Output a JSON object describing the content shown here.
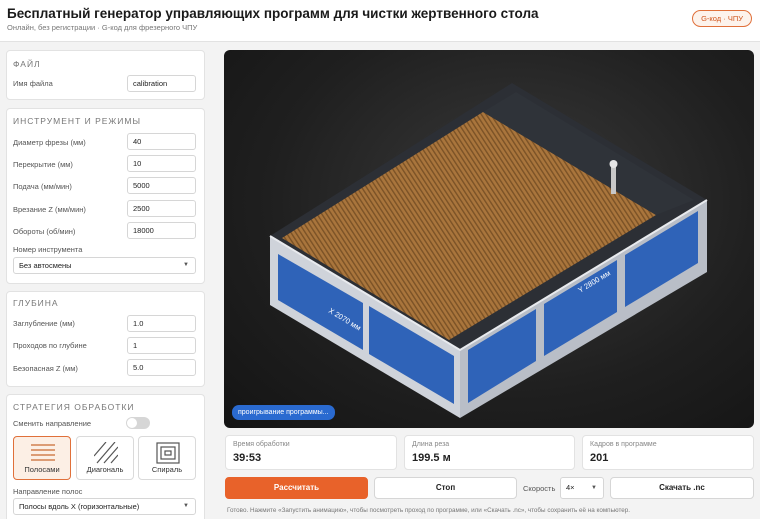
{
  "header": {
    "title": "Бесплатный генератор управляющих программ для чистки жертвенного стола",
    "subtitle": "Онлайн, без регистрации · G-код для фрезерного ЧПУ",
    "badge": "G-код · ЧПУ"
  },
  "file": {
    "section_title": "ФАЙЛ",
    "filename_label": "Имя файла",
    "filename_value": "calibration"
  },
  "tool": {
    "section_title": "ИНСТРУМЕНТ И РЕЖИМЫ",
    "fields": [
      {
        "label": "Диаметр фрезы (мм)",
        "value": "40"
      },
      {
        "label": "Перекрытие (мм)",
        "value": "10"
      },
      {
        "label": "Подача (мм/мин)",
        "value": "5000"
      },
      {
        "label": "Врезание Z (мм/мин)",
        "value": "2500"
      },
      {
        "label": "Обороты (об/мин)",
        "value": "18000"
      }
    ],
    "tool_number_label": "Номер инструмента",
    "tool_number_value": "Без автосмены"
  },
  "depth": {
    "section_title": "ГЛУБИНА",
    "fields": [
      {
        "label": "Заглубление (мм)",
        "value": "1.0"
      },
      {
        "label": "Проходов по глубине",
        "value": "1"
      },
      {
        "label": "Безопасная Z (мм)",
        "value": "5.0"
      }
    ]
  },
  "strategy": {
    "section_title": "СТРАТЕГИЯ ОБРАБОТКИ",
    "toggle_label": "Сменить направление",
    "toggle_on": false,
    "options": [
      {
        "label": "Полосами",
        "icon": "stripes-icon",
        "active": true
      },
      {
        "label": "Диагональ",
        "icon": "diagonal-icon",
        "active": false
      },
      {
        "label": "Спираль",
        "icon": "spiral-icon",
        "active": false
      }
    ],
    "direction_label": "Направление полос",
    "direction_value": "Полосы вдоль X (горизонтальные)"
  },
  "viewer": {
    "x_dim_label": "X 2070 мм",
    "y_dim_label": "Y 2800 мм",
    "playback_pill": "проигрывание программы..."
  },
  "stats": [
    {
      "label": "Время обработки",
      "value": "39:53"
    },
    {
      "label": "Длина реза",
      "value": "199.5 м"
    },
    {
      "label": "Кадров в программе",
      "value": "201"
    }
  ],
  "actions": {
    "calculate": "Рассчитать",
    "stop": "Стоп",
    "speed_label": "Скорость",
    "speed_value": "4×",
    "download": "Скачать .nc"
  },
  "status_text": "Готово. Нажмите «Запустить анимацию», чтобы посмотреть проход по программе, или «Скачать .nc», чтобы сохранить её на компьютер.",
  "colors": {
    "accent": "#e8622a",
    "panel_blue": "#2f63b8",
    "frame_gray": "#d9dce2",
    "wood": "#a9753c"
  }
}
